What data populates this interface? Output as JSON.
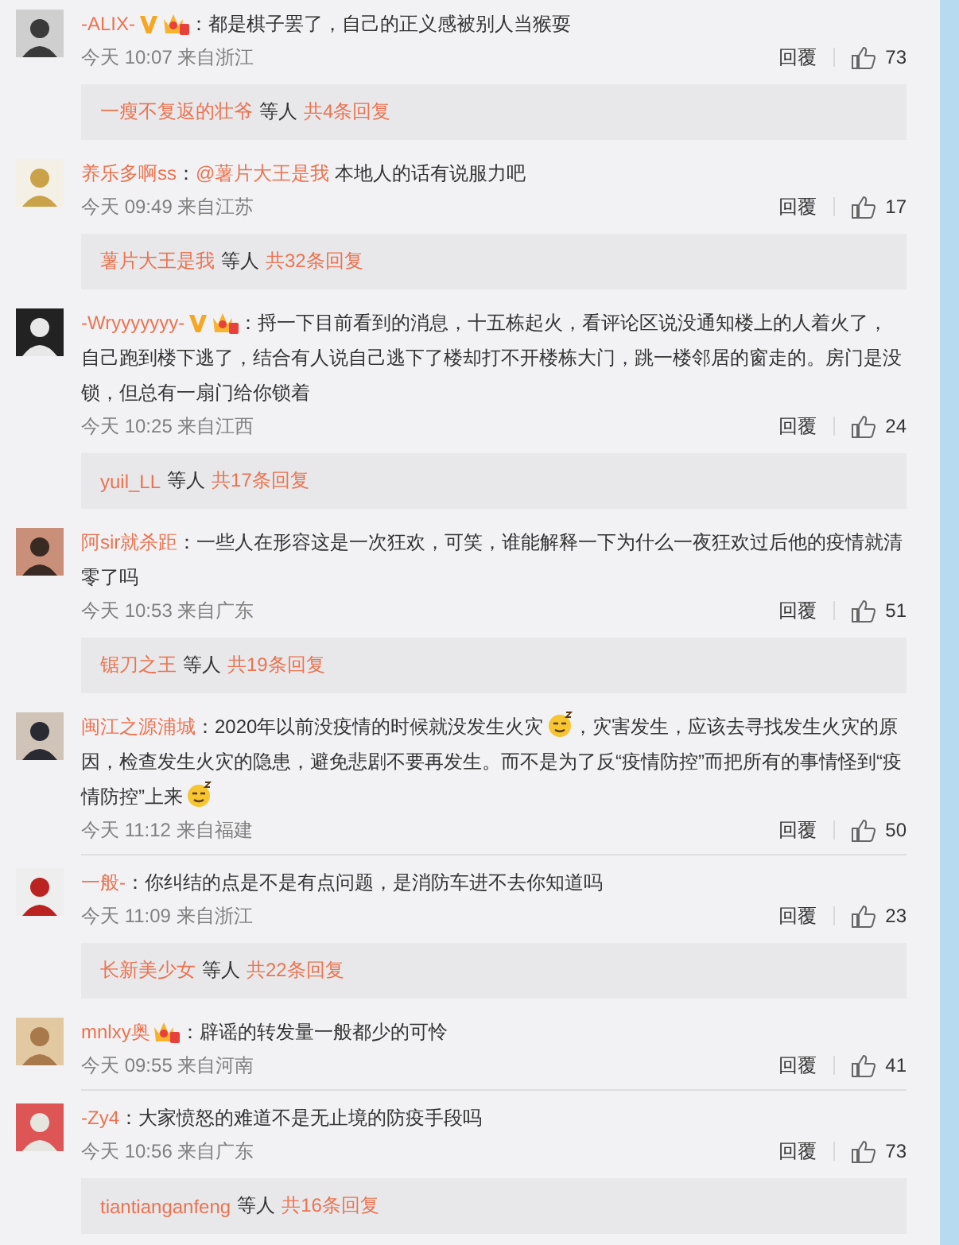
{
  "comments": [
    {
      "user": "-ALIX-",
      "badges": [
        {
          "kind": "verified"
        },
        {
          "kind": "vip"
        }
      ],
      "content": [
        {
          "kind": "text",
          "text": "：都是棋子罢了，自己的正义感被别人当猴耍"
        }
      ],
      "time": "今天 10:07",
      "source": "来自浙江",
      "reply_label": "回覆",
      "likes": "73",
      "replies": {
        "names": "一瘦不复返的壮爷",
        "others": "等人",
        "count": "共4条回复"
      }
    },
    {
      "user": "养乐多啊ss",
      "content": [
        {
          "kind": "text",
          "text": "："
        },
        {
          "kind": "mention",
          "text": "@薯片大王是我"
        },
        {
          "kind": "text",
          "text": " 本地人的话有说服力吧"
        }
      ],
      "time": "今天 09:49",
      "source": "来自江苏",
      "reply_label": "回覆",
      "likes": "17",
      "replies": {
        "names": "薯片大王是我",
        "others": "等人",
        "count": "共32条回复"
      }
    },
    {
      "user": "-Wryyyyyyy-",
      "badges": [
        {
          "kind": "verified"
        },
        {
          "kind": "vip"
        }
      ],
      "content": [
        {
          "kind": "text",
          "text": "：捋一下目前看到的消息，十五栋起火，看评论区说没通知楼上的人着火了，自己跑到楼下逃了，结合有人说自己逃下了楼却打不开楼栋大门，跳一楼邻居的窗走的。房门是没锁，但总有一扇门给你锁着"
        }
      ],
      "time": "今天 10:25",
      "source": "来自江西",
      "reply_label": "回覆",
      "likes": "24",
      "replies": {
        "names": "yuil_LL",
        "others": "等人",
        "count": "共17条回复"
      }
    },
    {
      "user": "阿sir就杀距",
      "content": [
        {
          "kind": "text",
          "text": "：一些人在形容这是一次狂欢，可笑，谁能解释一下为什么一夜狂欢过后他的疫情就清零了吗"
        }
      ],
      "time": "今天 10:53",
      "source": "来自广东",
      "reply_label": "回覆",
      "likes": "51",
      "replies": {
        "names": "锯刀之王",
        "others": "等人",
        "count": "共19条回复"
      }
    },
    {
      "user": "闽江之源浦城",
      "content": [
        {
          "kind": "text",
          "text": "：2020年以前没疫情的时候就没发生火灾"
        },
        {
          "kind": "emoji"
        },
        {
          "kind": "text",
          "text": "，灾害发生，应该去寻找发生火灾的原因，检查发生火灾的隐患，避免悲剧不要再发生。而不是为了反“疫情防控”而把所有的事情怪到“疫情防控”上来"
        },
        {
          "kind": "emoji"
        }
      ],
      "time": "今天 11:12",
      "source": "来自福建",
      "reply_label": "回覆",
      "likes": "50"
    },
    {
      "user": "一般-",
      "content": [
        {
          "kind": "text",
          "text": "：你纠结的点是不是有点问题，是消防车进不去你知道吗"
        }
      ],
      "time": "今天 11:09",
      "source": "来自浙江",
      "reply_label": "回覆",
      "likes": "23",
      "replies": {
        "names": "长新美少女",
        "others": "等人",
        "count": "共22条回复"
      }
    },
    {
      "user": "mnlxy奥",
      "badges": [
        {
          "kind": "vip"
        }
      ],
      "content": [
        {
          "kind": "text",
          "text": "：辟谣的转发量一般都少的可怜"
        }
      ],
      "time": "今天 09:55",
      "source": "来自河南",
      "reply_label": "回覆",
      "likes": "41"
    },
    {
      "user": "-Zy4",
      "content": [
        {
          "kind": "text",
          "text": "：大家愤怒的难道不是无止境的防疫手段吗"
        }
      ],
      "time": "今天 10:56",
      "source": "来自广东",
      "reply_label": "回覆",
      "likes": "73",
      "replies": {
        "names": "tiantianganfeng",
        "others": "等人",
        "count": "共16条回复"
      }
    }
  ]
}
